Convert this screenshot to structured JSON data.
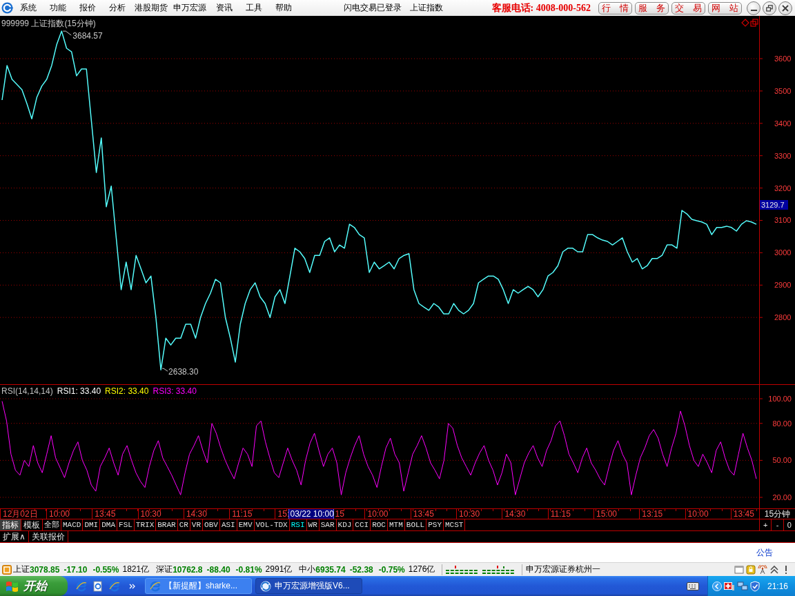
{
  "menu_bar": {
    "items": [
      "系统",
      "功能",
      "报价",
      "分析",
      "港股期货",
      "申万宏源",
      "资讯",
      "工具",
      "帮助"
    ],
    "login_status": "闪电交易已登录",
    "current_index": "上证指数",
    "hotline": "客服电话: 4008-000-562",
    "shortcut_buttons": [
      "行 情",
      "服 务",
      "交 易",
      "网 站"
    ]
  },
  "price_chart": {
    "chart_data": {
      "type": "line",
      "title": "999999 上证指数(15分钟)",
      "series": [
        {
          "color": "#54fcfc",
          "values": [
            3472,
            3579,
            3536,
            3520,
            3504,
            3461,
            3414,
            3480,
            3515,
            3536,
            3579,
            3643,
            3685,
            3632,
            3621,
            3547,
            3568,
            3568,
            3408,
            3248,
            3355,
            3142,
            3206,
            3046,
            2886,
            2971,
            2886,
            2992,
            2950,
            2907,
            2928,
            2800,
            2638,
            2736,
            2715,
            2736,
            2736,
            2779,
            2779,
            2736,
            2800,
            2843,
            2875,
            2918,
            2907,
            2800,
            2736,
            2662,
            2779,
            2843,
            2886,
            2907,
            2864,
            2843,
            2800,
            2864,
            2886,
            2843,
            2928,
            3014,
            3003,
            2982,
            2939,
            2992,
            2992,
            3035,
            3046,
            3003,
            3024,
            3014,
            3088,
            3078,
            3056,
            3046,
            2939,
            2971,
            2950,
            2960,
            2971,
            2950,
            2982,
            2992,
            2997,
            2886,
            2843,
            2832,
            2822,
            2843,
            2832,
            2811,
            2811,
            2843,
            2822,
            2811,
            2822,
            2843,
            2907,
            2918,
            2928,
            2928,
            2918,
            2886,
            2843,
            2886,
            2875,
            2886,
            2896,
            2886,
            2864,
            2886,
            2928,
            2939,
            2960,
            3003,
            3014,
            3014,
            3003,
            3003,
            3056,
            3056,
            3046,
            3039,
            3035,
            3024,
            3035,
            3046,
            3003,
            2971,
            2982,
            2950,
            2960,
            2982,
            2982,
            2992,
            3024,
            3024,
            3014,
            3131,
            3120,
            3103,
            3099,
            3095,
            3088,
            3056,
            3078,
            3078,
            3082,
            3078,
            3067,
            3088,
            3099,
            3095,
            3088
          ]
        }
      ],
      "ylim": [
        2593.6,
        3732.2
      ],
      "yticks": [
        2800,
        2900,
        3000,
        3100,
        3200,
        3300,
        3400,
        3500,
        3600
      ],
      "grid": true,
      "annotations": [
        "3684.57",
        "2638.30"
      ]
    },
    "price_marker": "3129.7"
  },
  "rsi_chart": {
    "legend": [
      {
        "label": "RSI(14,14,14)",
        "color": "#c0c0c0"
      },
      {
        "label": "RSI1: 33.40",
        "color": "#ffffff"
      },
      {
        "label": "RSI2: 33.40",
        "color": "#ffff00"
      },
      {
        "label": "RSI3: 33.40",
        "color": "#ff00ff"
      }
    ],
    "chart_data": {
      "type": "line",
      "series": [
        {
          "color": "#ff00ff",
          "values": [
            98,
            82,
            55,
            42,
            38,
            50,
            45,
            62,
            48,
            40,
            55,
            70,
            52,
            44,
            36,
            48,
            58,
            65,
            50,
            42,
            30,
            25,
            45,
            52,
            60,
            48,
            38,
            55,
            62,
            50,
            40,
            33,
            28,
            45,
            58,
            66,
            52,
            45,
            38,
            30,
            22,
            40,
            55,
            62,
            70,
            58,
            48,
            80,
            72,
            60,
            50,
            42,
            35,
            48,
            60,
            55,
            45,
            78,
            82,
            65,
            52,
            40,
            36,
            48,
            60,
            50,
            42,
            30,
            50,
            64,
            72,
            58,
            45,
            55,
            60,
            48,
            22,
            40,
            52,
            62,
            70,
            55,
            45,
            38,
            28,
            45,
            60,
            68,
            55,
            48,
            25,
            40,
            55,
            62,
            70,
            60,
            48,
            42,
            35,
            50,
            80,
            76,
            62,
            52,
            45,
            38,
            48,
            56,
            62,
            50,
            42,
            30,
            40,
            55,
            48,
            22,
            35,
            48,
            56,
            62,
            52,
            45,
            58,
            66,
            78,
            82,
            70,
            55,
            48,
            40,
            52,
            60,
            48,
            42,
            35,
            30,
            45,
            58,
            66,
            55,
            48,
            22,
            38,
            52,
            60,
            70,
            75,
            68,
            55,
            45,
            60,
            72,
            90,
            78,
            62,
            50,
            45,
            55,
            48,
            40,
            58,
            65,
            52,
            42,
            38,
            55,
            72,
            60,
            50,
            35
          ]
        }
      ],
      "ylim": [
        11.05,
        111.19
      ],
      "yticks": [
        {
          "value": 20,
          "label": "20.00"
        },
        {
          "value": 50,
          "label": "50.00"
        },
        {
          "value": 80,
          "label": "80.00"
        },
        {
          "value": 100,
          "label": "100.00"
        }
      ],
      "grid": true
    }
  },
  "time_axis": {
    "labels": [
      {
        "kind": "date",
        "label": "12月02日"
      },
      {
        "kind": "tick",
        "label": "10:00"
      },
      {
        "kind": "tick",
        "label": "13:45"
      },
      {
        "kind": "tick",
        "label": "10:30"
      },
      {
        "kind": "tick",
        "label": "14:30"
      },
      {
        "kind": "tick",
        "label": "11:15"
      },
      {
        "kind": "tick-head",
        "label": "15:"
      },
      {
        "kind": "cursor",
        "label": "03/22 10:00"
      },
      {
        "kind": "tick-tail",
        "label": "15"
      },
      {
        "kind": "tick",
        "label": "10:00"
      },
      {
        "kind": "tick",
        "label": "13:45"
      },
      {
        "kind": "tick",
        "label": "10:30"
      },
      {
        "kind": "tick",
        "label": "14:30"
      },
      {
        "kind": "tick",
        "label": "11:15"
      },
      {
        "kind": "tick",
        "label": "15:00"
      },
      {
        "kind": "tick",
        "label": "13:15"
      },
      {
        "kind": "tick",
        "label": "10:00"
      },
      {
        "kind": "tick",
        "label": "13:45"
      }
    ],
    "period": "15分钟"
  },
  "mode_tabs": [
    {
      "label": "指标",
      "selected": true
    },
    {
      "label": "模板",
      "selected": false
    }
  ],
  "indicator_tabs": [
    {
      "label": "全部",
      "selected": false
    },
    {
      "label": "MACD",
      "selected": false
    },
    {
      "label": "DMI",
      "selected": false
    },
    {
      "label": "DMA",
      "selected": false
    },
    {
      "label": "FSL",
      "selected": false
    },
    {
      "label": "TRIX",
      "selected": false
    },
    {
      "label": "BRAR",
      "selected": false
    },
    {
      "label": "CR",
      "selected": false
    },
    {
      "label": "VR",
      "selected": false
    },
    {
      "label": "OBV",
      "selected": false
    },
    {
      "label": "ASI",
      "selected": false
    },
    {
      "label": "EMV",
      "selected": false
    },
    {
      "label": "VOL-TDX",
      "selected": false
    },
    {
      "label": "RSI",
      "selected": true
    },
    {
      "label": "WR",
      "selected": false
    },
    {
      "label": "SAR",
      "selected": false
    },
    {
      "label": "KDJ",
      "selected": false
    },
    {
      "label": "CCI",
      "selected": false
    },
    {
      "label": "ROC",
      "selected": false
    },
    {
      "label": "MTM",
      "selected": false
    },
    {
      "label": "BOLL",
      "selected": false
    },
    {
      "label": "PSY",
      "selected": false
    },
    {
      "label": "MCST",
      "selected": false
    }
  ],
  "zoom_buttons": [
    "+",
    "-",
    "0"
  ],
  "panel_tabs": [
    "扩展∧",
    "关联报价"
  ],
  "notice_link": "公告",
  "status_bar": {
    "quotes": [
      {
        "name": "上证",
        "price": "3078.85",
        "change": "-17.10",
        "percent": "-0.55%",
        "amount": "1821亿",
        "down": true
      },
      {
        "name": "深证",
        "price": "10762.8",
        "change": "-88.40",
        "percent": "-0.81%",
        "amount": "2991亿",
        "down": true
      },
      {
        "name": "中小",
        "price": "6935.74",
        "change": "-52.38",
        "percent": "-0.75%",
        "amount": "1276亿",
        "down": true
      }
    ],
    "broker": "申万宏源证券杭州一"
  },
  "taskbar": {
    "start": "开始",
    "tasks": [
      {
        "label": "【新提醒】sharke...",
        "selected": false
      },
      {
        "label": "申万宏源增强版V6...",
        "selected": true
      }
    ],
    "clock": "21:16"
  }
}
